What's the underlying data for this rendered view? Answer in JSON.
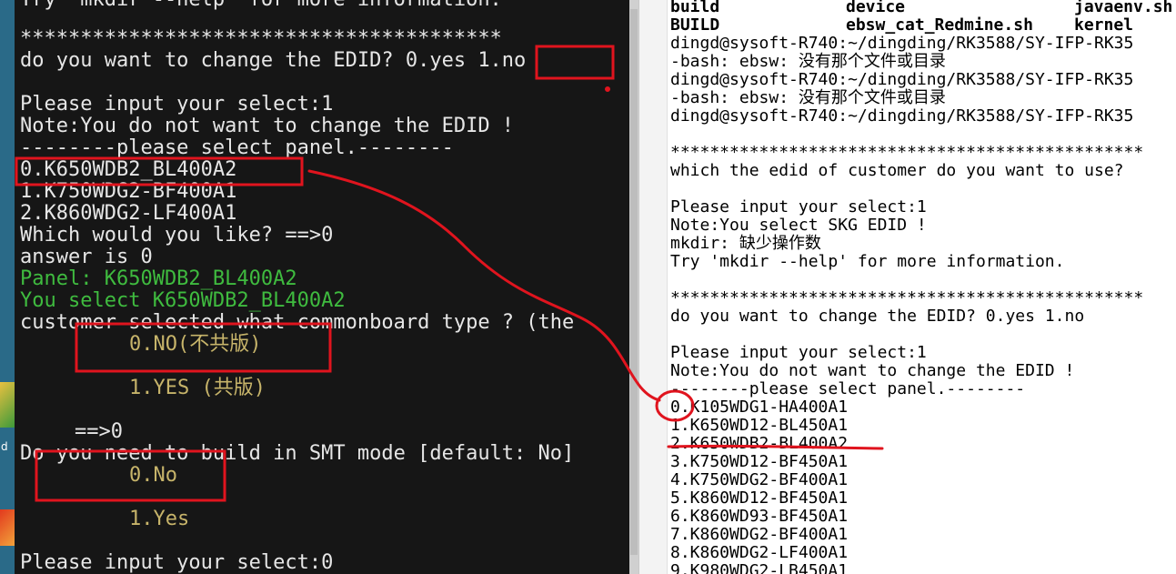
{
  "left_terminal": {
    "lines": [
      "Try 'mkdir --help' for more information.",
      "****************************************",
      "do you want to change the EDID? 0.yes 1.no",
      "Please input your select:1",
      "Note:You do not want to change the EDID !",
      "--------please select panel.--------",
      "0.K650WDB2_BL400A2",
      "1.K750WDG2-BF400A1",
      "2.K860WDG2-LF400A1",
      "Which would you like? ==>0",
      "answer is 0",
      "Panel: K650WDB2_BL400A2",
      "You select K650WDB2_BL400A2",
      "customer selected what commonboard type ? (the",
      "0.NO(不共版)",
      "1.YES (共版)",
      "==>0",
      "Do you need to build in SMT mode [default: No]",
      "0.No",
      "1.Yes",
      "Please input your select:0"
    ]
  },
  "right_terminal": {
    "header_rows": [
      [
        "build",
        "device",
        "javaenv.sh"
      ],
      [
        "BUILD",
        "ebsw_cat_Redmine.sh",
        "kernel"
      ]
    ],
    "lines": [
      "dingd@sysoft-R740:~/dingding/RK3588/SY-IFP-RK35",
      "-bash: ebsw: 没有那个文件或目录",
      "dingd@sysoft-R740:~/dingding/RK3588/SY-IFP-RK35",
      "-bash: ebsw: 没有那个文件或目录",
      "dingd@sysoft-R740:~/dingding/RK3588/SY-IFP-RK35",
      "************************************************",
      "which the edid of customer do you want to use?",
      "Please input your select:1",
      "Note:You select SKG EDID !",
      "mkdir: 缺少操作数",
      "Try 'mkdir --help' for more information.",
      "************************************************",
      "do you want to change the EDID? 0.yes 1.no",
      "Please input your select:1",
      "Note:You do not want to change the EDID !",
      "--------please select panel.--------",
      "0.K105WDG1-HA400A1",
      "1.K650WD12-BL450A1",
      "2.K650WDB2-BL400A2",
      "3.K750WD12-BF450A1",
      "4.K750WDG2-BF400A1",
      "5.K860WD12-BF450A1",
      "6.K860WD93-BF450A1",
      "7.K860WDG2-BF400A1",
      "8.K860WDG2-LF400A1",
      "9.K980WDG2-LB450A1"
    ]
  },
  "desktop": {
    "icon_label": "d"
  },
  "colors": {
    "annotation": "#e0141e",
    "terminal_bg": "#161616",
    "green_text": "#3fbb3f",
    "yellow_text": "#c7b46a"
  }
}
